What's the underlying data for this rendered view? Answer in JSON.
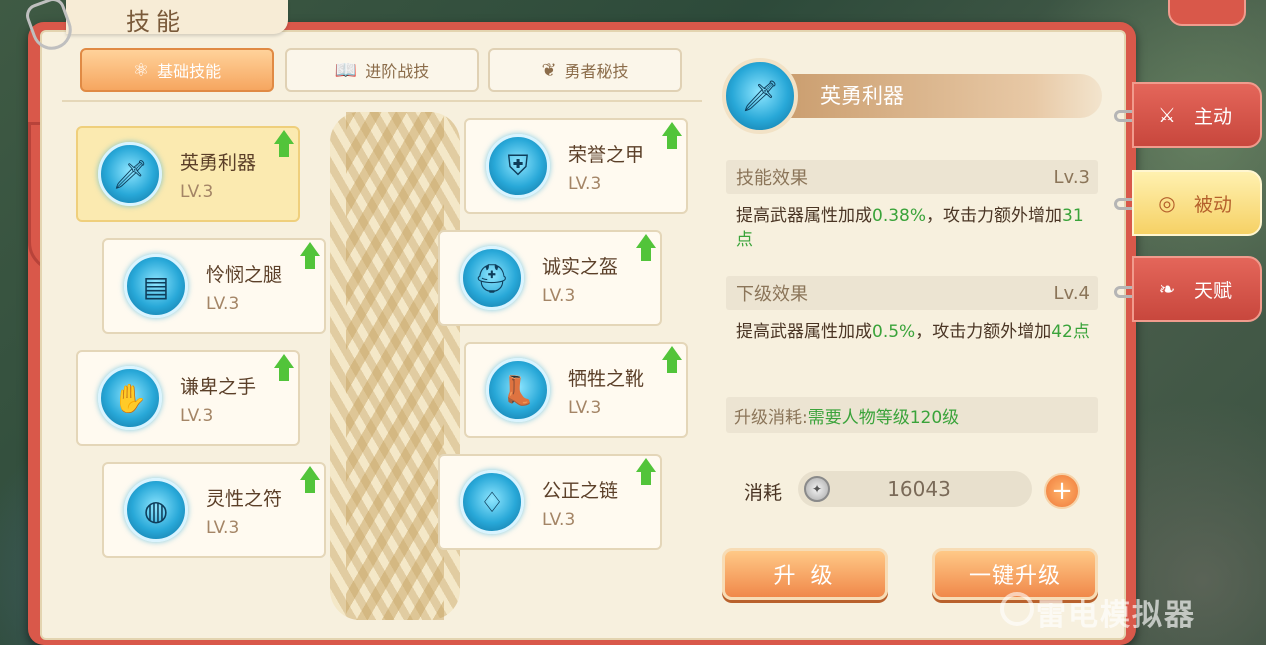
{
  "window": {
    "title": "技能"
  },
  "tabs": [
    {
      "label": "基础技能",
      "icon": "atom-icon",
      "active": true
    },
    {
      "label": "进阶战技",
      "icon": "book-icon",
      "active": false
    },
    {
      "label": "勇者秘技",
      "icon": "wing-icon",
      "active": false
    }
  ],
  "skills": [
    {
      "name": "英勇利器",
      "level": "LV.3",
      "icon": "sword-icon",
      "selected": true
    },
    {
      "name": "荣誉之甲",
      "level": "LV.3",
      "icon": "armor-icon",
      "selected": false
    },
    {
      "name": "怜悯之腿",
      "level": "LV.3",
      "icon": "belt-icon",
      "selected": false
    },
    {
      "name": "诚实之盔",
      "level": "LV.3",
      "icon": "helmet-icon",
      "selected": false
    },
    {
      "name": "谦卑之手",
      "level": "LV.3",
      "icon": "glove-icon",
      "selected": false
    },
    {
      "name": "牺牲之靴",
      "level": "LV.3",
      "icon": "boots-icon",
      "selected": false
    },
    {
      "name": "灵性之符",
      "level": "LV.3",
      "icon": "ring-icon",
      "selected": false
    },
    {
      "name": "公正之链",
      "level": "LV.3",
      "icon": "necklace-icon",
      "selected": false
    }
  ],
  "detail": {
    "name": "英勇利器",
    "current": {
      "label": "技能效果",
      "level": "Lv.3",
      "text_prefix": "提高武器属性加成",
      "value1": "0.38%",
      "text_middle": "，攻击力额外增加",
      "value2": "31点"
    },
    "next": {
      "label": "下级效果",
      "level": "Lv.4",
      "text_prefix": "提高武器属性加成",
      "value1": "0.5%",
      "text_middle": "，攻击力额外增加",
      "value2": "42点"
    },
    "upgrade_cost": {
      "label": "升级消耗:",
      "requirement": "需要人物等级120级"
    },
    "consume": {
      "label": "消耗",
      "value": "16043"
    }
  },
  "buttons": {
    "upgrade": "升 级",
    "one_click_upgrade": "一键升级",
    "plus": "+"
  },
  "side_tabs": [
    {
      "label": "主动",
      "icon": "claw-icon",
      "active": false
    },
    {
      "label": "被动",
      "icon": "swirl-icon",
      "active": true
    },
    {
      "label": "天赋",
      "icon": "flame-wing-icon",
      "active": false
    }
  ],
  "watermark": "雷电模拟器",
  "colors": {
    "accent_orange": "#f0884a",
    "highlight_green": "#3aa33a",
    "book_red": "#d9584a",
    "skill_blue": "#28a8d8"
  }
}
